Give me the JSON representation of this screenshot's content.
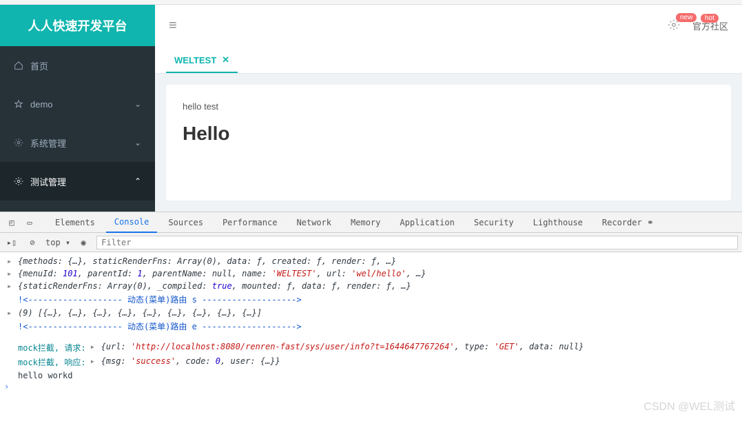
{
  "brand": "人人快速开发平台",
  "sidebar": {
    "items": [
      {
        "icon": "home",
        "label": "首页",
        "expandable": false
      },
      {
        "icon": "star",
        "label": "demo",
        "expandable": true
      },
      {
        "icon": "gear",
        "label": "系统管理",
        "expandable": true
      },
      {
        "icon": "gear",
        "label": "测试管理",
        "expandable": true,
        "open": true
      }
    ]
  },
  "topbar": {
    "badge_new": "new",
    "community_label": "官方社区",
    "badge_hot": "hot"
  },
  "tabs": [
    {
      "label": "WELTEST",
      "active": true
    }
  ],
  "content": {
    "subtext": "hello test",
    "heading": "Hello"
  },
  "devtools": {
    "tabs": [
      "Elements",
      "Console",
      "Sources",
      "Performance",
      "Network",
      "Memory",
      "Application",
      "Security",
      "Lighthouse",
      "Recorder ⚭"
    ],
    "active_tab": "Console",
    "toolbar": {
      "context": "top ▾",
      "filter_placeholder": "Filter"
    },
    "logs": {
      "l1": {
        "pre": "{methods: {…}, staticRenderFns: Array(0), data: ƒ, created: ƒ, render: ƒ, …}"
      },
      "l2": {
        "pre": "{menuId: ",
        "menuId": "101",
        "mid1": ", parentId: ",
        "parentId": "1",
        "mid2": ", parentName: ",
        "parentName": "null",
        "mid3": ", name: ",
        "name": "'WELTEST'",
        "mid4": ", url: ",
        "url": "'wel/hello'",
        "post": ", …}"
      },
      "l3": {
        "pre": "{staticRenderFns: Array(0), _compiled: ",
        "compiled": "true",
        "mid": ", mounted: ƒ, data: ƒ, render: ƒ, …}"
      },
      "dyn_s": "!<------------------- 动态(菜单)路由 s ------------------->",
      "arr": "(9) [{…}, {…}, {…}, {…}, {…}, {…}, {…}, {…}, {…}]",
      "dyn_e": "!<------------------- 动态(菜单)路由 e ------------------->",
      "mock_req": {
        "label": "mock拦截, 请求: ",
        "pre": "{url: ",
        "url": "'http://localhost:8080/renren-fast/sys/user/info?t=1644647767264'",
        "mid": ", type: ",
        "type": "'GET'",
        "mid2": ", data: ",
        "data": "null",
        "post": "}"
      },
      "mock_res": {
        "label": "mock拦截, 响应: ",
        "pre": "{msg: ",
        "msg": "'success'",
        "mid": ", code: ",
        "code": "0",
        "mid2": ", user: {…}}"
      },
      "hello": "hello workd"
    }
  },
  "watermark": "CSDN @WEL测试"
}
